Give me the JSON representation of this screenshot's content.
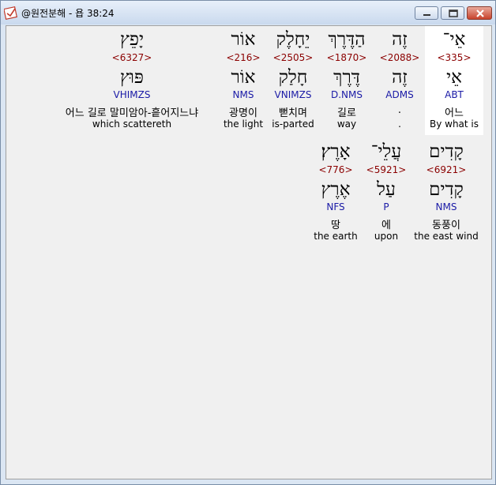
{
  "window": {
    "title": "@원전분해 - 욥 38:24",
    "controls": [
      "minimize-icon",
      "maximize-icon",
      "close-icon"
    ]
  },
  "colors": {
    "strong": "#8b0000",
    "morph": "#1a1aa6",
    "highlight": "#ffffff"
  },
  "row1": [
    {
      "heb_pointed": "אֵי־",
      "strong": "<335>",
      "heb_root": "אֵי",
      "morph": "ABT",
      "kor": "어느",
      "eng": "By what is"
    },
    {
      "heb_pointed": "זֶה",
      "strong": "<2088>",
      "heb_root": "זֶה",
      "morph": "ADMS",
      "kor": ".",
      "eng": "."
    },
    {
      "heb_pointed": "הַדֶּרֶךְ",
      "strong": "<1870>",
      "heb_root": "דֶּרֶךְ",
      "morph": "D.NMS",
      "kor": "길로",
      "eng": "way"
    },
    {
      "heb_pointed": "יֵחָלֶק",
      "strong": "<2505>",
      "heb_root": "חָלַק",
      "morph": "VNIMZS",
      "kor": "뻗치며",
      "eng": "is-parted"
    },
    {
      "heb_pointed": "אוֹר",
      "strong": "<216>",
      "heb_root": "אוֹר",
      "morph": "NMS",
      "kor": "광명이",
      "eng": "the light"
    },
    {
      "heb_pointed": "יָפֵץ",
      "strong": "<6327>",
      "heb_root": "פּוּץ",
      "morph": "VHIMZS",
      "kor": "어느 길로 말미암아-흩어지느냐",
      "eng": "which scattereth"
    }
  ],
  "row2": [
    {
      "heb_pointed": "קָדִים",
      "strong": "<6921>",
      "heb_root": "קָדִים",
      "morph": "NMS",
      "kor": "동풍이",
      "eng": "the east wind"
    },
    {
      "heb_pointed": "עֲלֵי־",
      "strong": "<5921>",
      "heb_root": "עַל",
      "morph": "P",
      "kor": "에",
      "eng": "upon"
    },
    {
      "heb_pointed": "אָרֶץ׃",
      "strong": "<776>",
      "heb_root": "אֶרֶץ",
      "morph": "NFS",
      "kor": "땅",
      "eng": "the earth"
    }
  ]
}
